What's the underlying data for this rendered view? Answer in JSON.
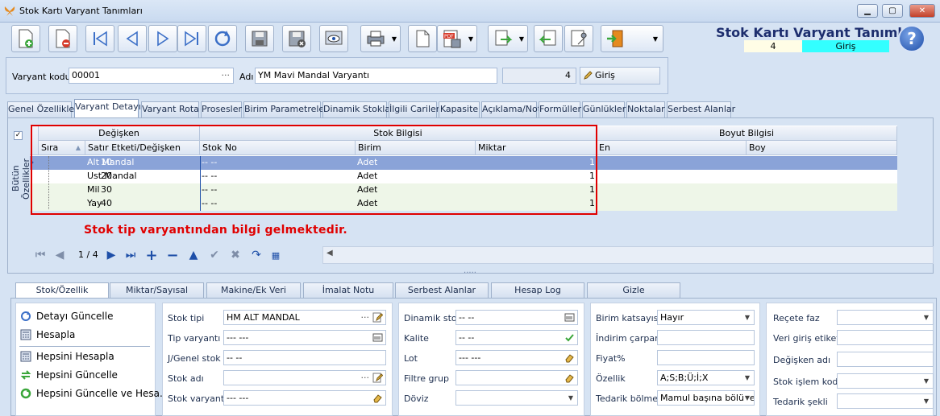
{
  "window": {
    "title": "Stok Kartı Varyant Tanımları"
  },
  "header": {
    "title": "Stok Kartı Varyant Tanımları",
    "number": "4",
    "mode": "Giriş"
  },
  "form": {
    "variant_code_label": "Varyant kodu",
    "variant_code_value": "00001",
    "name_label": "Adı",
    "name_value": "YM Mavi Mandal Varyantı",
    "count_value": "4",
    "mode_button": "Giriş"
  },
  "tabs": [
    "Genel Özellikler",
    "Varyant Detayı",
    "Varyant Rota",
    "Prosesler",
    "Birim Parametreleri",
    "Dinamik Stoklar",
    "İlgili Cariler",
    "Kapasite",
    "Açıklama/Not",
    "Formüller",
    "Günlükler",
    "Noktalar",
    "Serbest Alanlar"
  ],
  "side_label": "Bütün Özellikler",
  "grid": {
    "groups": {
      "degisken": "Değişken",
      "stok": "Stok Bilgisi",
      "boyut": "Boyut Bilgisi"
    },
    "columns": {
      "sira": "Sıra",
      "satir": "Satır Etketi/Değişken",
      "stok_no": "Stok No",
      "birim": "Birim",
      "miktar": "Miktar",
      "en": "En",
      "boy": "Boy"
    },
    "rows": [
      {
        "sira": "10",
        "satir": "Alt Mandal",
        "stok_no": "-- --",
        "birim": "Adet",
        "miktar": "1"
      },
      {
        "sira": "20",
        "satir": "Ust Mandal",
        "stok_no": "-- --",
        "birim": "Adet",
        "miktar": "1"
      },
      {
        "sira": "30",
        "satir": "Mil",
        "stok_no": "-- --",
        "birim": "Adet",
        "miktar": "1"
      },
      {
        "sira": "40",
        "satir": "Yay",
        "stok_no": "-- --",
        "birim": "Adet",
        "miktar": "1"
      }
    ]
  },
  "note": "Stok tip varyantından bilgi gelmektedir.",
  "navigator": {
    "position": "1 / 4"
  },
  "bottom_tabs": [
    "Stok/Özellik",
    "Miktar/Sayısal",
    "Makine/Ek Veri",
    "İmalat Notu",
    "Serbest Alanlar",
    "Hesap Log",
    "Gizle"
  ],
  "actions": [
    "Detayı Güncelle",
    "Hesapla",
    "Hepsini Hesapla",
    "Hepsini Güncelle",
    "Hepsini Güncelle ve Hesa..."
  ],
  "fields1": [
    {
      "label": "Stok tipi",
      "value": "HM ALT MANDAL"
    },
    {
      "label": "Tip varyantı",
      "value": "--- ---"
    },
    {
      "label": "J/Genel stok",
      "value": "-- --"
    },
    {
      "label": "Stok adı",
      "value": ""
    },
    {
      "label": "Stok varyantı",
      "value": "--- ---"
    }
  ],
  "fields2": [
    {
      "label": "Dinamik stok",
      "value": "-- --"
    },
    {
      "label": "Kalite",
      "value": "-- --"
    },
    {
      "label": "Lot",
      "value": "--- ---"
    },
    {
      "label": "Filtre grup",
      "value": ""
    },
    {
      "label": "Döviz",
      "value": ""
    }
  ],
  "fields3": [
    {
      "label": "Birim katsayısı",
      "value": "Hayır"
    },
    {
      "label": "İndirim çarpanı",
      "value": ""
    },
    {
      "label": "Fiyat%",
      "value": ""
    },
    {
      "label": "Özellik",
      "value": "A;S;B;Ü;İ;X"
    },
    {
      "label": "Tedarik bölme",
      "value": "Mamul başına bölüne"
    }
  ],
  "fields4": [
    {
      "label": "Reçete faz",
      "value": ""
    },
    {
      "label": "Veri giriş etiketi",
      "value": ""
    },
    {
      "label": "Değişken adı",
      "value": ""
    },
    {
      "label": "Stok işlem kodu",
      "value": ""
    },
    {
      "label": "Tedarik şekli",
      "value": ""
    }
  ],
  "colors": {
    "accent": "#1d2e6e",
    "selection": "#8aa3d8",
    "highlight": "#e00000",
    "mode_bg": "#33ffff"
  }
}
